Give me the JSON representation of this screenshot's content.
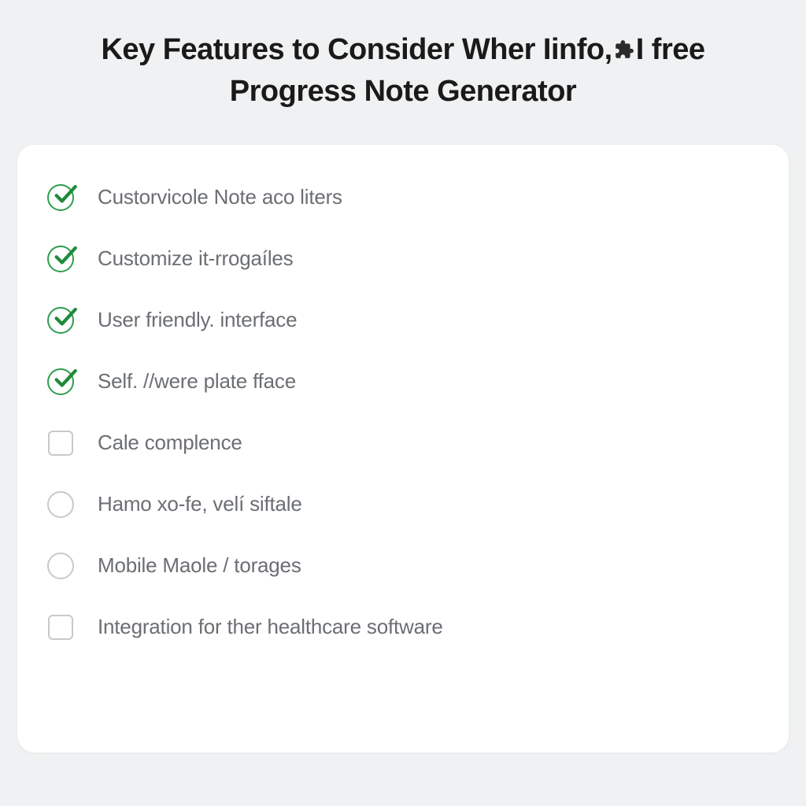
{
  "title_line1": "Key Features to Consider Wher Iinfo,",
  "title_line1b": "I free",
  "title_line2": "Progress Note Generator",
  "items": [
    {
      "label": "Custorvicole Note aco liters",
      "state": "checked",
      "shape": "circle"
    },
    {
      "label": "Customize it-rrogaíles",
      "state": "checked",
      "shape": "circle"
    },
    {
      "label": "User friendly. interface",
      "state": "checked",
      "shape": "circle"
    },
    {
      "label": "Self. //were plate fface",
      "state": "checked",
      "shape": "circle"
    },
    {
      "label": "Cale complence",
      "state": "empty",
      "shape": "square"
    },
    {
      "label": "Hamo xo-fe, velí siftale",
      "state": "empty",
      "shape": "circle"
    },
    {
      "label": "Mobile Maole / torages",
      "state": "empty",
      "shape": "circle"
    },
    {
      "label": "Integration for ther healthcare software",
      "state": "empty",
      "shape": "square"
    }
  ]
}
